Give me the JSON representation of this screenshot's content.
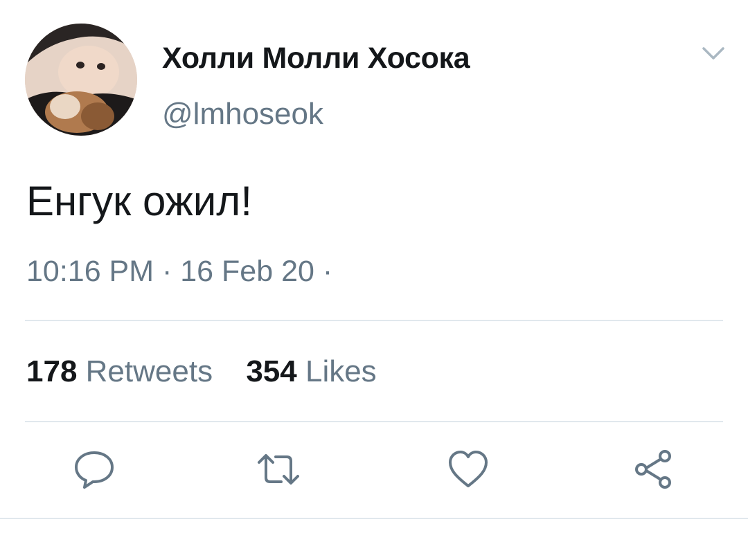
{
  "user": {
    "display_name": "Холли Молли Хосока",
    "handle": "@lmhoseok"
  },
  "tweet": {
    "text": "Енгук ожил!",
    "meta": "10:16 PM · 16 Feb 20 ·"
  },
  "stats": {
    "retweets_count": "178",
    "retweets_label": "Retweets",
    "likes_count": "354",
    "likes_label": "Likes"
  },
  "icons": {
    "menu": "chevron-down-icon",
    "reply": "reply-icon",
    "retweet": "retweet-icon",
    "like": "heart-icon",
    "share": "share-icon"
  },
  "colors": {
    "text_primary": "#14171a",
    "text_secondary": "#657786",
    "divider": "#e1e8ed"
  }
}
